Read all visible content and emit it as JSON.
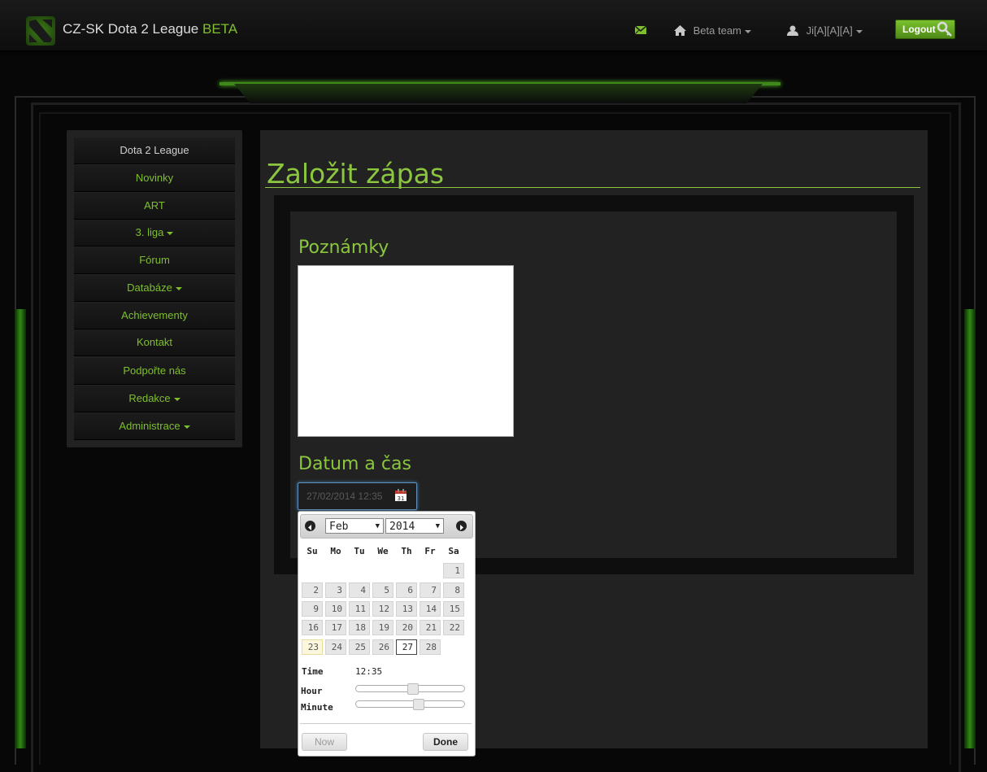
{
  "header": {
    "brand": "CZ-SK Dota 2 League",
    "brand_beta": "BETA",
    "team_menu": "Beta team",
    "user_menu": "Ji[A][A][A]",
    "logout": "Logout"
  },
  "sidebar": {
    "items": [
      {
        "label": "Dota 2 League",
        "dropdown": false
      },
      {
        "label": "Novinky",
        "dropdown": false
      },
      {
        "label": "ART",
        "dropdown": false
      },
      {
        "label": "3. liga",
        "dropdown": true
      },
      {
        "label": "Fórum",
        "dropdown": false
      },
      {
        "label": "Databáze",
        "dropdown": true
      },
      {
        "label": "Achievementy",
        "dropdown": false
      },
      {
        "label": "Kontakt",
        "dropdown": false
      },
      {
        "label": "Podpořte nás",
        "dropdown": false
      },
      {
        "label": "Redakce",
        "dropdown": true
      },
      {
        "label": "Administrace",
        "dropdown": true
      }
    ]
  },
  "main": {
    "title": "Založit zápas",
    "notes_label": "Poznámky",
    "notes_value": "",
    "datetime_label": "Datum a čas",
    "datetime_value": "27/02/2014 12:35"
  },
  "datepicker": {
    "month": "Feb",
    "year": "2014",
    "weekdays": [
      "Su",
      "Mo",
      "Tu",
      "We",
      "Th",
      "Fr",
      "Sa"
    ],
    "days": [
      "1",
      "2",
      "3",
      "4",
      "5",
      "6",
      "7",
      "8",
      "9",
      "10",
      "11",
      "12",
      "13",
      "14",
      "15",
      "16",
      "17",
      "18",
      "19",
      "20",
      "21",
      "22",
      "23",
      "24",
      "25",
      "26",
      "27",
      "28"
    ],
    "today": "23",
    "selected": "27",
    "time_label": "Time",
    "time_value": "12:35",
    "hour_label": "Hour",
    "minute_label": "Minute",
    "hour_level": 0.52,
    "minute_level": 0.58,
    "now_button": "Now",
    "done_button": "Done"
  },
  "colors": {
    "accent": "#8bc63f",
    "background": "#070707",
    "panel": "#222222"
  }
}
